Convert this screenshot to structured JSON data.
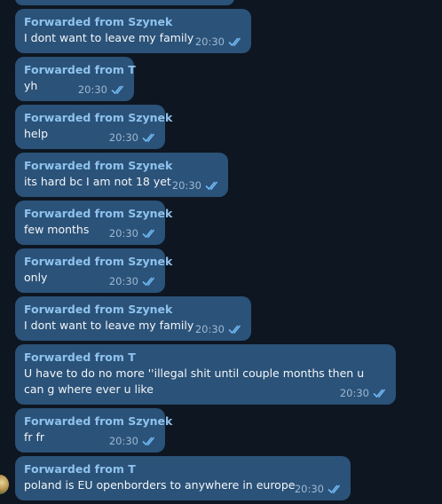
{
  "messages": [
    {
      "from": "Forwarded from Szynek",
      "text": "I dont want to leave my family",
      "time": "20:30"
    },
    {
      "from": "Forwarded from T",
      "text": "yh",
      "time": "20:30"
    },
    {
      "from": "Forwarded from Szynek",
      "text": "help",
      "time": "20:30"
    },
    {
      "from": "Forwarded from Szynek",
      "text": "its hard bc I am not 18 yet",
      "time": "20:30"
    },
    {
      "from": "Forwarded from Szynek",
      "text": "few months",
      "time": "20:30"
    },
    {
      "from": "Forwarded from Szynek",
      "text": "only",
      "time": "20:30"
    },
    {
      "from": "Forwarded from Szynek",
      "text": "I dont want to leave my family",
      "time": "20:30"
    },
    {
      "from": "Forwarded from T",
      "text": "U  have to do no more ''illegal shit until couple months then u can g where ever u like",
      "time": "20:30"
    },
    {
      "from": "Forwarded from Szynek",
      "text": "fr fr",
      "time": "20:30"
    },
    {
      "from": "Forwarded from T",
      "text": "poland is EU openborders to anywhere in europe",
      "time": "20:30"
    }
  ],
  "colors": {
    "background": "#0e1621",
    "bubble": "#2b5278",
    "forward_label": "#8fc3ef",
    "time": "#9cb8d3",
    "read_ticks": "#6fb6f2"
  }
}
